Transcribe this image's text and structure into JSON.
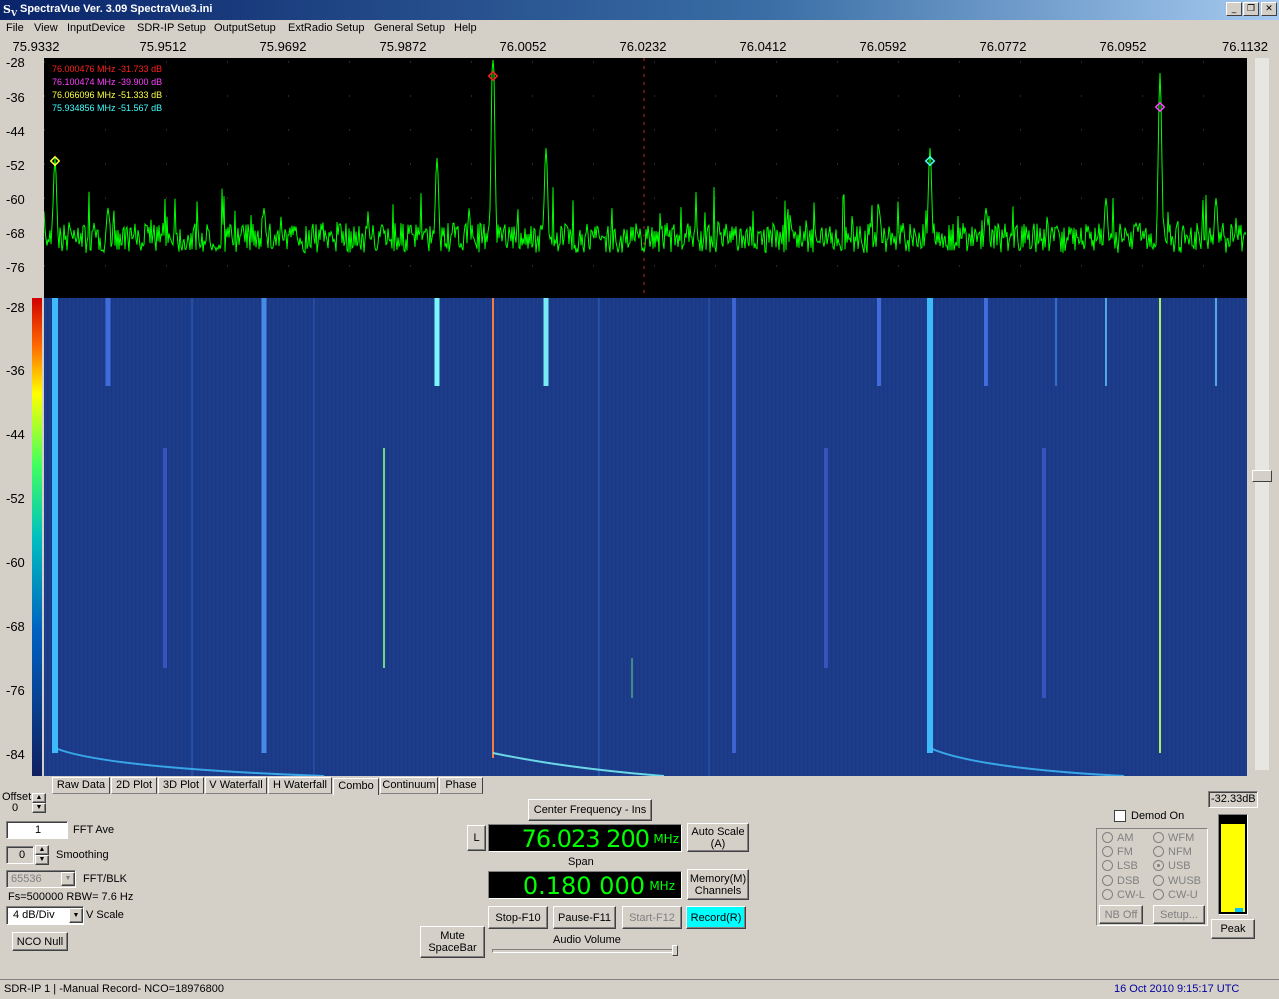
{
  "window": {
    "icon": "sv-logo-icon",
    "title": "SpectraVue Ver. 3.09   SpectraVue3.ini",
    "minimize_glyph": "_",
    "restore_glyph": "❐",
    "close_glyph": "✕"
  },
  "menu": [
    "File",
    "View",
    "InputDevice",
    "SDR-IP Setup",
    "OutputSetup",
    "ExtRadio Setup",
    "General Setup",
    "Help"
  ],
  "freq_axis": [
    "75.9332",
    "75.9512",
    "75.9692",
    "75.9872",
    "76.0052",
    "76.0232",
    "76.0412",
    "76.0592",
    "76.0772",
    "76.0952",
    "76.1132"
  ],
  "spectrum_db_axis": [
    "-28",
    "-36",
    "-44",
    "-52",
    "-60",
    "-68",
    "-76"
  ],
  "waterfall_db_axis": [
    "-28",
    "-36",
    "-44",
    "-52",
    "-60",
    "-68",
    "-76",
    "-84"
  ],
  "markers": [
    {
      "text": "76.000476 MHz  -31.733  dB",
      "color": "#ff2020"
    },
    {
      "text": "76.100474 MHz  -39.900  dB",
      "color": "#ff40ff"
    },
    {
      "text": "76.066096 MHz  -51.333  dB",
      "color": "#ffff40"
    },
    {
      "text": "75.934856 MHz  -51.567  dB",
      "color": "#40ffff"
    }
  ],
  "tabs": [
    "Raw Data",
    "2D Plot",
    "3D Plot",
    "V Waterfall",
    "H Waterfall",
    "Combo",
    "Continuum",
    "Phase"
  ],
  "controls": {
    "offset_label": "Offset",
    "offset_value": "0",
    "fft_ave_value": "1",
    "fft_ave_label": "FFT Ave",
    "smoothing_value": "0",
    "smoothing_label": "Smoothing",
    "fft_blk_value": "65536",
    "fft_blk_label": "FFT/BLK",
    "fs_info": "Fs=500000 RBW= 7.6 Hz",
    "vscale_value": "4 dB/Div",
    "vscale_label": "V Scale",
    "nco_null": "NCO Null"
  },
  "center": {
    "center_freq_button": "Center Frequency - Ins",
    "l_button": "L",
    "freq_value": "76.023 200",
    "freq_unit": "MHz",
    "auto_scale": "Auto Scale\n(A)",
    "span_label": "Span",
    "span_value": "0.180 000",
    "span_unit": "MHz",
    "memory": "Memory(M)\nChannels",
    "mute": "Mute\nSpaceBar",
    "stop": "Stop-F10",
    "pause": "Pause-F11",
    "start": "Start-F12",
    "record": "Record(R)",
    "audio_volume": "Audio Volume"
  },
  "demod": {
    "demod_on": "Demod On",
    "modes_left": [
      "AM",
      "FM",
      "LSB",
      "DSB",
      "CW-L"
    ],
    "modes_right": [
      "WFM",
      "NFM",
      "USB",
      "WUSB",
      "CW-U"
    ],
    "selected": "USB",
    "nb_off": "NB Off",
    "setup": "Setup..."
  },
  "meter": {
    "value": "-32.33dB",
    "peak": "Peak",
    "level": 0.93
  },
  "status": {
    "left": "SDR-IP 1  | -Manual Record-   NCO=18976800",
    "datetime": "16 Oct 2010  9:15:17 UTC"
  }
}
